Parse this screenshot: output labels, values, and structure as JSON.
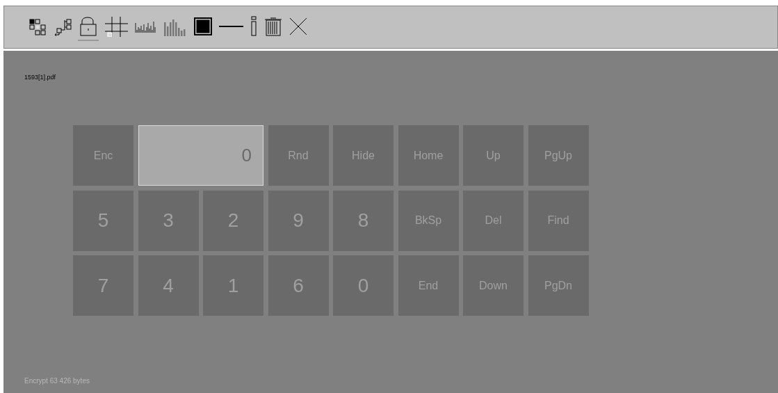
{
  "toolbar": {
    "tools": [
      {
        "kind": "tiles",
        "selected": false
      },
      {
        "kind": "tree",
        "selected": false
      },
      {
        "kind": "lock",
        "selected": true
      },
      {
        "kind": "grid",
        "selected": false
      },
      {
        "kind": "bars",
        "selected": false
      },
      {
        "kind": "histogram",
        "selected": false
      },
      {
        "kind": "square",
        "selected": false
      },
      {
        "kind": "line",
        "selected": false
      },
      {
        "kind": "info",
        "selected": false
      },
      {
        "kind": "trash",
        "selected": false
      },
      {
        "kind": "close",
        "selected": false
      }
    ]
  },
  "file_name": "1593[1].pdf",
  "keypad": {
    "keys": [
      {
        "kind": "key",
        "label": "Enc"
      },
      {
        "kind": "display",
        "label": "0"
      },
      {
        "kind": "key",
        "label": "Rnd"
      },
      {
        "kind": "key",
        "label": "Hide"
      },
      {
        "kind": "key",
        "label": "Home"
      },
      {
        "kind": "key",
        "label": "Up"
      },
      {
        "kind": "key",
        "label": "PgUp"
      },
      {
        "kind": "digit",
        "label": "5"
      },
      {
        "kind": "digit",
        "label": "3"
      },
      {
        "kind": "digit",
        "label": "2"
      },
      {
        "kind": "digit",
        "label": "9"
      },
      {
        "kind": "digit",
        "label": "8"
      },
      {
        "kind": "key",
        "label": "BkSp"
      },
      {
        "kind": "key",
        "label": "Del"
      },
      {
        "kind": "key",
        "label": "Find"
      },
      {
        "kind": "digit",
        "label": "7"
      },
      {
        "kind": "digit",
        "label": "4"
      },
      {
        "kind": "digit",
        "label": "1"
      },
      {
        "kind": "digit",
        "label": "6"
      },
      {
        "kind": "digit",
        "label": "0"
      },
      {
        "kind": "key",
        "label": "End"
      },
      {
        "kind": "key",
        "label": "Down"
      },
      {
        "kind": "key",
        "label": "PgDn"
      }
    ]
  },
  "status": "Encrypt 63 426 bytes"
}
